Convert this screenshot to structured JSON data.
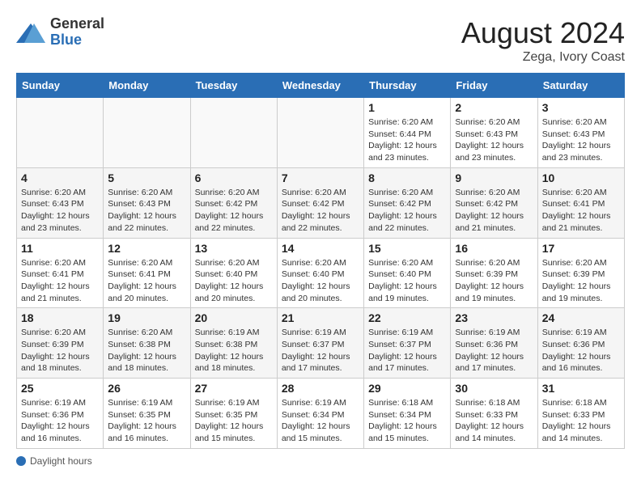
{
  "header": {
    "logo_general": "General",
    "logo_blue": "Blue",
    "month_year": "August 2024",
    "location": "Zega, Ivory Coast"
  },
  "days_of_week": [
    "Sunday",
    "Monday",
    "Tuesday",
    "Wednesday",
    "Thursday",
    "Friday",
    "Saturday"
  ],
  "weeks": [
    [
      {
        "day": "",
        "info": ""
      },
      {
        "day": "",
        "info": ""
      },
      {
        "day": "",
        "info": ""
      },
      {
        "day": "",
        "info": ""
      },
      {
        "day": "1",
        "info": "Sunrise: 6:20 AM\nSunset: 6:44 PM\nDaylight: 12 hours and 23 minutes."
      },
      {
        "day": "2",
        "info": "Sunrise: 6:20 AM\nSunset: 6:43 PM\nDaylight: 12 hours and 23 minutes."
      },
      {
        "day": "3",
        "info": "Sunrise: 6:20 AM\nSunset: 6:43 PM\nDaylight: 12 hours and 23 minutes."
      }
    ],
    [
      {
        "day": "4",
        "info": "Sunrise: 6:20 AM\nSunset: 6:43 PM\nDaylight: 12 hours and 23 minutes."
      },
      {
        "day": "5",
        "info": "Sunrise: 6:20 AM\nSunset: 6:43 PM\nDaylight: 12 hours and 22 minutes."
      },
      {
        "day": "6",
        "info": "Sunrise: 6:20 AM\nSunset: 6:42 PM\nDaylight: 12 hours and 22 minutes."
      },
      {
        "day": "7",
        "info": "Sunrise: 6:20 AM\nSunset: 6:42 PM\nDaylight: 12 hours and 22 minutes."
      },
      {
        "day": "8",
        "info": "Sunrise: 6:20 AM\nSunset: 6:42 PM\nDaylight: 12 hours and 22 minutes."
      },
      {
        "day": "9",
        "info": "Sunrise: 6:20 AM\nSunset: 6:42 PM\nDaylight: 12 hours and 21 minutes."
      },
      {
        "day": "10",
        "info": "Sunrise: 6:20 AM\nSunset: 6:41 PM\nDaylight: 12 hours and 21 minutes."
      }
    ],
    [
      {
        "day": "11",
        "info": "Sunrise: 6:20 AM\nSunset: 6:41 PM\nDaylight: 12 hours and 21 minutes."
      },
      {
        "day": "12",
        "info": "Sunrise: 6:20 AM\nSunset: 6:41 PM\nDaylight: 12 hours and 20 minutes."
      },
      {
        "day": "13",
        "info": "Sunrise: 6:20 AM\nSunset: 6:40 PM\nDaylight: 12 hours and 20 minutes."
      },
      {
        "day": "14",
        "info": "Sunrise: 6:20 AM\nSunset: 6:40 PM\nDaylight: 12 hours and 20 minutes."
      },
      {
        "day": "15",
        "info": "Sunrise: 6:20 AM\nSunset: 6:40 PM\nDaylight: 12 hours and 19 minutes."
      },
      {
        "day": "16",
        "info": "Sunrise: 6:20 AM\nSunset: 6:39 PM\nDaylight: 12 hours and 19 minutes."
      },
      {
        "day": "17",
        "info": "Sunrise: 6:20 AM\nSunset: 6:39 PM\nDaylight: 12 hours and 19 minutes."
      }
    ],
    [
      {
        "day": "18",
        "info": "Sunrise: 6:20 AM\nSunset: 6:39 PM\nDaylight: 12 hours and 18 minutes."
      },
      {
        "day": "19",
        "info": "Sunrise: 6:20 AM\nSunset: 6:38 PM\nDaylight: 12 hours and 18 minutes."
      },
      {
        "day": "20",
        "info": "Sunrise: 6:19 AM\nSunset: 6:38 PM\nDaylight: 12 hours and 18 minutes."
      },
      {
        "day": "21",
        "info": "Sunrise: 6:19 AM\nSunset: 6:37 PM\nDaylight: 12 hours and 17 minutes."
      },
      {
        "day": "22",
        "info": "Sunrise: 6:19 AM\nSunset: 6:37 PM\nDaylight: 12 hours and 17 minutes."
      },
      {
        "day": "23",
        "info": "Sunrise: 6:19 AM\nSunset: 6:36 PM\nDaylight: 12 hours and 17 minutes."
      },
      {
        "day": "24",
        "info": "Sunrise: 6:19 AM\nSunset: 6:36 PM\nDaylight: 12 hours and 16 minutes."
      }
    ],
    [
      {
        "day": "25",
        "info": "Sunrise: 6:19 AM\nSunset: 6:36 PM\nDaylight: 12 hours and 16 minutes."
      },
      {
        "day": "26",
        "info": "Sunrise: 6:19 AM\nSunset: 6:35 PM\nDaylight: 12 hours and 16 minutes."
      },
      {
        "day": "27",
        "info": "Sunrise: 6:19 AM\nSunset: 6:35 PM\nDaylight: 12 hours and 15 minutes."
      },
      {
        "day": "28",
        "info": "Sunrise: 6:19 AM\nSunset: 6:34 PM\nDaylight: 12 hours and 15 minutes."
      },
      {
        "day": "29",
        "info": "Sunrise: 6:18 AM\nSunset: 6:34 PM\nDaylight: 12 hours and 15 minutes."
      },
      {
        "day": "30",
        "info": "Sunrise: 6:18 AM\nSunset: 6:33 PM\nDaylight: 12 hours and 14 minutes."
      },
      {
        "day": "31",
        "info": "Sunrise: 6:18 AM\nSunset: 6:33 PM\nDaylight: 12 hours and 14 minutes."
      }
    ]
  ],
  "footer": {
    "label": "Daylight hours"
  }
}
